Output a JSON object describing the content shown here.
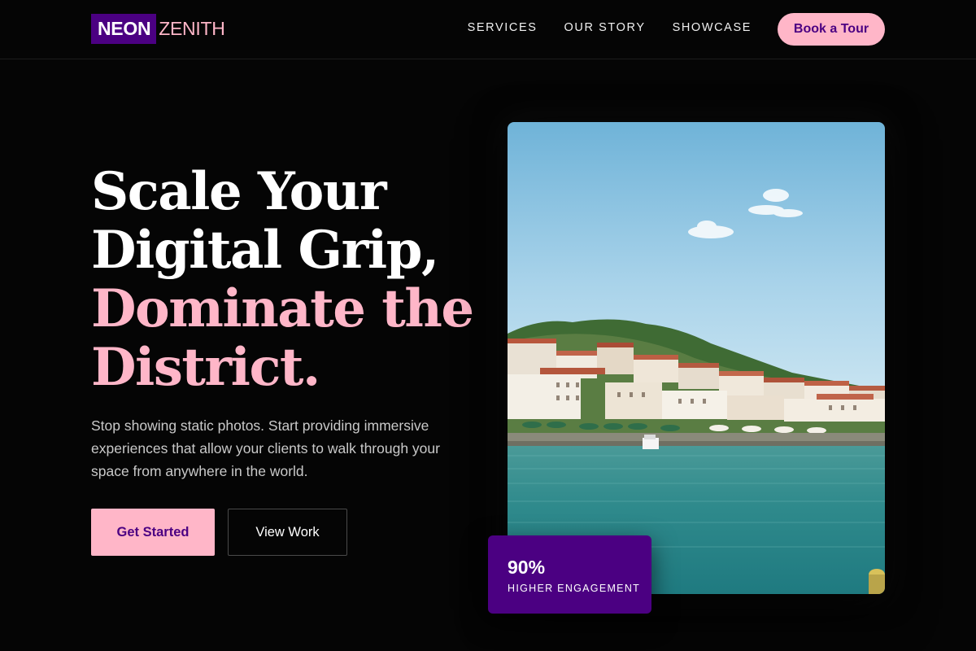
{
  "header": {
    "logo_part1": "NEON",
    "logo_part2": "ZENITH",
    "nav": [
      "SERVICES",
      "OUR STORY",
      "SHOWCASE"
    ],
    "cta_label": "Book a Tour"
  },
  "hero": {
    "headline_line1": "Scale Your",
    "headline_line2": "Digital Grip,",
    "headline_line3": "Dominate the",
    "headline_line4": "District.",
    "subtext": "Stop showing static photos. Start providing immersive experiences that allow your clients to walk through your space from anywhere in the world.",
    "primary_button": "Get Started",
    "secondary_button": "View Work"
  },
  "stat": {
    "value": "90%",
    "label": "HIGHER ENGAGEMENT"
  },
  "colors": {
    "accent_pink": "#ffb6c8",
    "brand_purple": "#4b0082",
    "background": "#050505"
  }
}
